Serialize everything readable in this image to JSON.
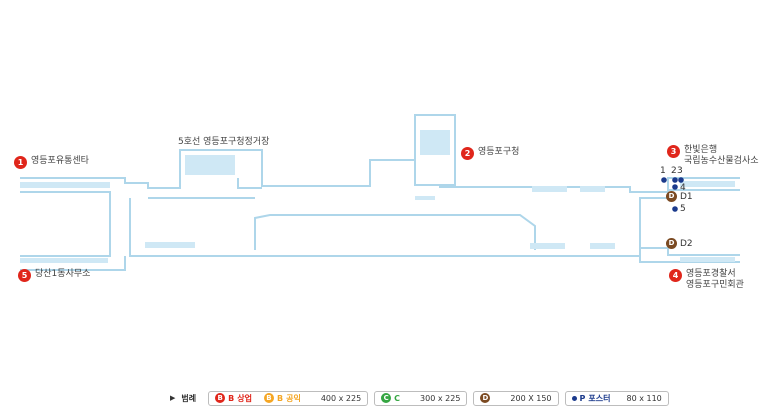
{
  "exits": [
    {
      "number": "1",
      "lines": [
        "영등포유통센타"
      ]
    },
    {
      "number": "2",
      "lines": [
        "영등포구청"
      ]
    },
    {
      "number": "3",
      "lines": [
        "한빛은행",
        "국립농수산물검사소"
      ]
    },
    {
      "number": "4",
      "lines": [
        "영등포경찰서",
        "영등포구민회관"
      ]
    },
    {
      "number": "5",
      "lines": [
        "당산1동사무소"
      ]
    }
  ],
  "platform_label": "5호선 영등포구청정거장",
  "pins": [
    "1",
    "2",
    "3",
    "4",
    "5"
  ],
  "d_markers": [
    {
      "code": "D",
      "label": "D1"
    },
    {
      "code": "D",
      "label": "D2"
    }
  ],
  "legend": {
    "title": "범례",
    "groups": [
      {
        "items": [
          {
            "badge": "B",
            "color": "#e0261b",
            "text": "B",
            "desc": "상업"
          },
          {
            "badge": "B",
            "color": "#f5a623",
            "text": "B",
            "desc": "공익"
          }
        ],
        "size": "400 x 225"
      },
      {
        "items": [
          {
            "badge": "C",
            "color": "#35a642",
            "text": "C",
            "desc": ""
          }
        ],
        "size": "300 x 225"
      },
      {
        "items": [
          {
            "badge": "D",
            "color": "#7b4a22",
            "text": "",
            "desc": ""
          }
        ],
        "size": "200 X 150"
      },
      {
        "items": [
          {
            "badge": "",
            "color": "#1b3a8c",
            "text": "P",
            "desc": "포스터"
          }
        ],
        "size": "80 x 110"
      }
    ]
  },
  "colors": {
    "corridor": "#aed6ea",
    "exit": "#e0261b",
    "pin": "#1b3a8c",
    "d_marker": "#7b4a22"
  }
}
